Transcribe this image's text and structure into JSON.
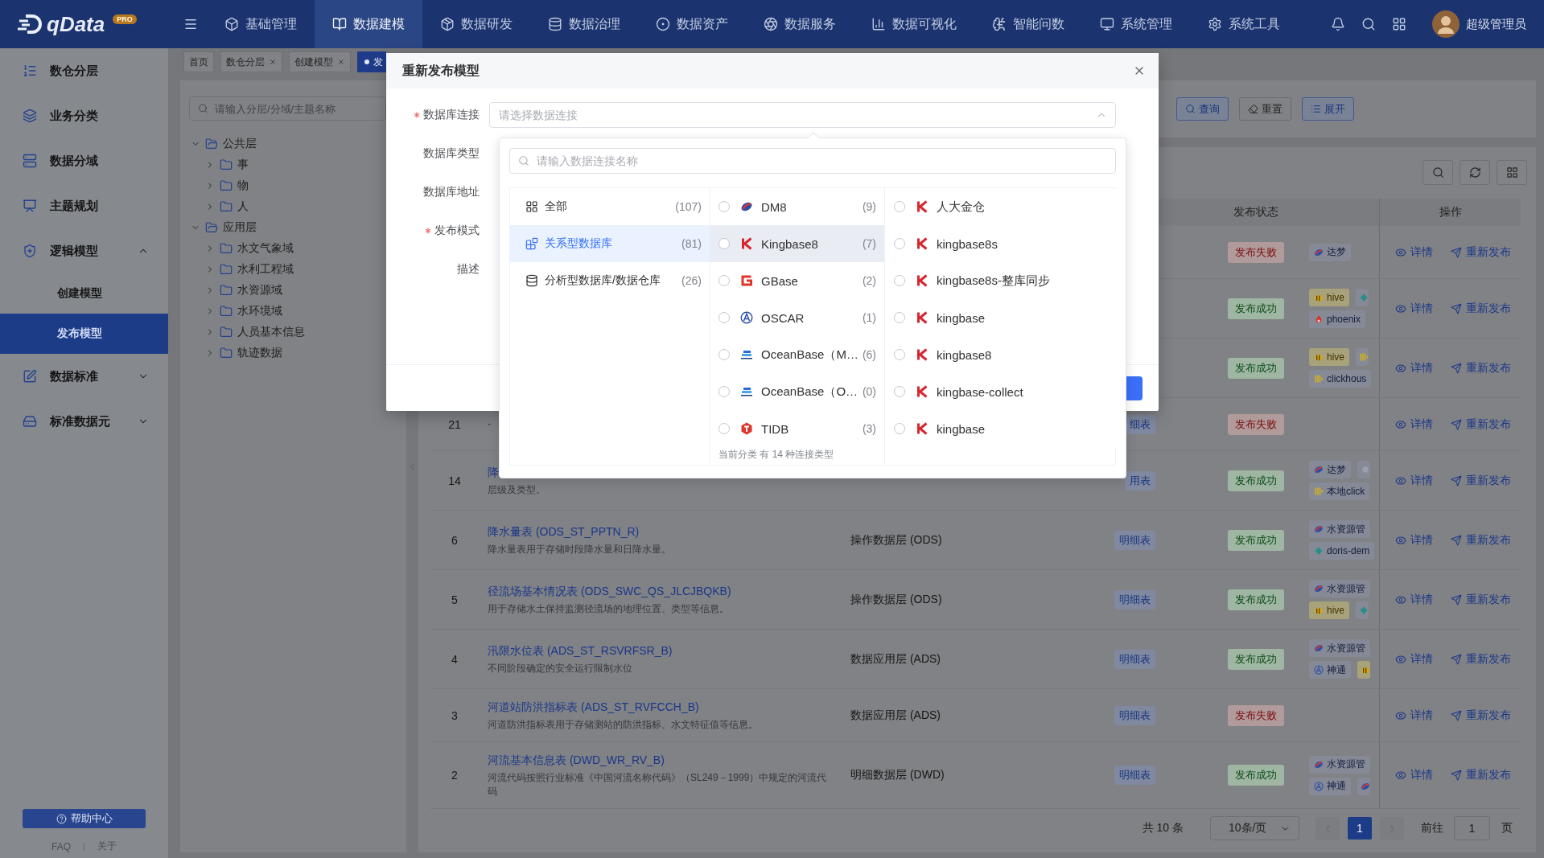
{
  "top_nav": {
    "logo": "qData",
    "badge": "PRO",
    "items": [
      {
        "label": "基础管理",
        "selected": false
      },
      {
        "label": "数据建模",
        "selected": true
      },
      {
        "label": "数据研发",
        "selected": false
      },
      {
        "label": "数据治理",
        "selected": false
      },
      {
        "label": "数据资产",
        "selected": false
      },
      {
        "label": "数据服务",
        "selected": false
      },
      {
        "label": "数据可视化",
        "selected": false
      },
      {
        "label": "智能问数",
        "selected": false
      },
      {
        "label": "系统管理",
        "selected": false
      },
      {
        "label": "系统工具",
        "selected": false
      }
    ],
    "user": "超级管理员"
  },
  "sidebar": {
    "items": [
      {
        "label": "数仓分层"
      },
      {
        "label": "业务分类"
      },
      {
        "label": "数据分域"
      },
      {
        "label": "主题规划"
      },
      {
        "label": "逻辑模型",
        "expanded": true,
        "children": [
          {
            "label": "创建模型",
            "selected": false
          },
          {
            "label": "发布模型",
            "selected": true
          }
        ]
      },
      {
        "label": "数据标准",
        "expanded": false
      },
      {
        "label": "标准数据元",
        "expanded": false
      }
    ],
    "help": "帮助中心",
    "links": [
      "FAQ",
      "关于"
    ]
  },
  "page_tabs": [
    {
      "label": "首页",
      "selected": false,
      "closable": false
    },
    {
      "label": "数仓分层",
      "selected": false,
      "closable": true
    },
    {
      "label": "创建模型",
      "selected": false,
      "closable": true
    },
    {
      "label": "发",
      "selected": true,
      "closable": false
    }
  ],
  "tree": {
    "search_placeholder": "请输入分层/分域/主题名称",
    "nodes": [
      {
        "label": "公共层",
        "expanded": true,
        "children": [
          {
            "label": "事",
            "expanded": false
          },
          {
            "label": "物",
            "expanded": false
          },
          {
            "label": "人",
            "expanded": false
          }
        ]
      },
      {
        "label": "应用层",
        "expanded": true,
        "children": [
          {
            "label": "水文气象域",
            "expanded": false
          },
          {
            "label": "水利工程域",
            "expanded": false
          },
          {
            "label": "水资源域",
            "expanded": false
          },
          {
            "label": "水环境域",
            "expanded": false
          },
          {
            "label": "人员基本信息",
            "expanded": false
          },
          {
            "label": "轨迹数据",
            "expanded": false
          }
        ]
      }
    ]
  },
  "search_form": {
    "buttons": [
      {
        "label": "查询",
        "kind": "primary"
      },
      {
        "label": "重置",
        "kind": "plain"
      },
      {
        "label": "展开",
        "kind": "primary"
      }
    ]
  },
  "table": {
    "header": {
      "status": "发布状态",
      "actions": "操作"
    },
    "rows": [
      {
        "status": {
          "label": "发布失败",
          "kind": "failed"
        },
        "sources": [
          [
            {
              "kind": "dameng",
              "label": "达梦"
            }
          ]
        ],
        "actions": [
          "详情",
          "重新发布"
        ]
      },
      {
        "status": {
          "label": "发布成功",
          "kind": "success"
        },
        "sources": [
          [
            {
              "kind": "hive",
              "label": "hive"
            },
            {
              "kind": "doris"
            }
          ],
          [
            {
              "kind": "phoenix",
              "label": "phoenix"
            }
          ]
        ],
        "actions": [
          "详情",
          "重新发布"
        ]
      },
      {
        "status": {
          "label": "发布成功",
          "kind": "success"
        },
        "sources": [
          [
            {
              "kind": "hive",
              "label": "hive"
            },
            {
              "kind": "clickhouse"
            }
          ],
          [
            {
              "kind": "clickhouse",
              "label": "clickhous"
            }
          ]
        ],
        "actions": [
          "详情",
          "重新发布"
        ]
      },
      {
        "index": "21",
        "description": "-",
        "type": "细表",
        "status": {
          "label": "发布失败",
          "kind": "failed"
        },
        "actions": [
          "详情",
          "重新发布"
        ]
      },
      {
        "index": "14",
        "name": "降",
        "description": "层级及类型。",
        "type": "用表",
        "status": {
          "label": "发布成功",
          "kind": "success"
        },
        "sources": [
          [
            {
              "kind": "dameng",
              "label": "达梦"
            },
            {
              "kind": "generic"
            }
          ],
          [
            {
              "kind": "clickhouse",
              "label": "本地click"
            }
          ]
        ],
        "actions": [
          "详情",
          "重新发布"
        ]
      },
      {
        "index": "6",
        "name": "降水量表 (ODS_ST_PPTN_R)",
        "description": "降水量表用于存储时段降水量和日降水量。",
        "layer": "操作数据层 (ODS)",
        "type": "明细表",
        "status": {
          "label": "发布成功",
          "kind": "success"
        },
        "sources": [
          [
            {
              "kind": "dameng",
              "label": "水资源管"
            }
          ],
          [
            {
              "kind": "doris",
              "label": "doris-dem"
            }
          ]
        ],
        "actions": [
          "详情",
          "重新发布"
        ]
      },
      {
        "index": "5",
        "name": "径流场基本情况表 (ODS_SWC_QS_JLCJBQKB)",
        "description": "用于存储水土保持监测径流场的地理位置、类型等信息。",
        "layer": "操作数据层 (ODS)",
        "type": "明细表",
        "status": {
          "label": "发布成功",
          "kind": "success"
        },
        "sources": [
          [
            {
              "kind": "dameng",
              "label": "水资源管"
            }
          ],
          [
            {
              "kind": "hive",
              "label": "hive"
            },
            {
              "kind": "doris"
            }
          ]
        ],
        "actions": [
          "详情",
          "重新发布"
        ]
      },
      {
        "index": "4",
        "name": "汛限水位表 (ADS_ST_RSVRFSR_B)",
        "description": "不同阶段确定的安全运行限制水位",
        "layer": "数据应用层 (ADS)",
        "type": "明细表",
        "status": {
          "label": "发布成功",
          "kind": "success"
        },
        "sources": [
          [
            {
              "kind": "dameng",
              "label": "水资源管"
            }
          ],
          [
            {
              "kind": "shentong",
              "label": "神通"
            },
            {
              "kind": "hive"
            }
          ]
        ],
        "actions": [
          "详情",
          "重新发布"
        ]
      },
      {
        "index": "3",
        "name": "河道站防洪指标表 (ADS_ST_RVFCCH_B)",
        "description": "河道防洪指标表用于存储测站的防洪指标、水文特征值等信息。",
        "layer": "数据应用层 (ADS)",
        "type": "明细表",
        "status": {
          "label": "发布失败",
          "kind": "failed"
        },
        "actions": [
          "详情",
          "重新发布"
        ]
      },
      {
        "index": "2",
        "name": "河流基本信息表 (DWD_WR_RV_B)",
        "description": "河流代码按照行业标准《中国河流名称代码》（SL249－1999）中规定的河流代码",
        "layer": "明细数据层 (DWD)",
        "type": "明细表",
        "status": {
          "label": "发布成功",
          "kind": "success"
        },
        "sources": [
          [
            {
              "kind": "dameng",
              "label": "水资源管"
            }
          ],
          [
            {
              "kind": "shentong",
              "label": "神通"
            },
            {
              "kind": "dameng"
            }
          ]
        ],
        "actions": [
          "详情",
          "重新发布"
        ]
      }
    ]
  },
  "pagination": {
    "total": "共 10 条",
    "page_size": "10条/页",
    "prev_disabled": true,
    "pages": [
      {
        "label": "1",
        "selected": true
      }
    ],
    "next_disabled": true,
    "goto_label": "前往",
    "goto_value": "1",
    "goto_suffix": "页"
  },
  "modal": {
    "title": "重新发布模型",
    "fields": [
      {
        "label": "数据库连接",
        "required": true,
        "placeholder": "请选择数据连接",
        "open": true
      },
      {
        "label": "数据库类型",
        "required": false
      },
      {
        "label": "数据库地址",
        "required": false
      },
      {
        "label": "发布模式",
        "required": true
      },
      {
        "label": "描述",
        "required": false
      }
    ],
    "dropdown": {
      "search_placeholder": "请输入数据连接名称",
      "categories": [
        {
          "label": "全部",
          "count": "(107)",
          "selected": false
        },
        {
          "label": "关系型数据库",
          "count": "(81)",
          "selected": true
        },
        {
          "label": "分析型数据库/数据仓库",
          "count": "(26)",
          "selected": false
        }
      ],
      "types": [
        {
          "label": "DM8",
          "count": "(9)",
          "kind": "dm",
          "checked": false,
          "hovered": false
        },
        {
          "label": "Kingbase8",
          "count": "(7)",
          "kind": "kingbase",
          "checked": false,
          "hovered": true
        },
        {
          "label": "GBase",
          "count": "(2)",
          "kind": "gbase",
          "checked": false,
          "hovered": false
        },
        {
          "label": "OSCAR",
          "count": "(1)",
          "kind": "oscar",
          "checked": false,
          "hovered": false
        },
        {
          "label": "OceanBase（M…",
          "count": "(6)",
          "kind": "oceanbase",
          "checked": false,
          "hovered": false
        },
        {
          "label": "OceanBase（O…",
          "count": "(0)",
          "kind": "oceanbase",
          "checked": false,
          "hovered": false
        },
        {
          "label": "TIDB",
          "count": "(3)",
          "kind": "tidb",
          "checked": false,
          "hovered": false
        }
      ],
      "note": "当前分类 有 14 种连接类型",
      "connections": [
        {
          "label": "人大金仓",
          "kind": "kingbase",
          "checked": false
        },
        {
          "label": "kingbase8s",
          "kind": "kingbase",
          "checked": false
        },
        {
          "label": "kingbase8s-整库同步",
          "kind": "kingbase",
          "checked": false
        },
        {
          "label": "kingbase",
          "kind": "kingbase",
          "checked": false
        },
        {
          "label": "kingbase8",
          "kind": "kingbase",
          "checked": false
        },
        {
          "label": "kingbase-collect",
          "kind": "kingbase",
          "checked": false
        },
        {
          "label": "kingbase",
          "kind": "kingbase",
          "checked": false
        }
      ]
    }
  }
}
